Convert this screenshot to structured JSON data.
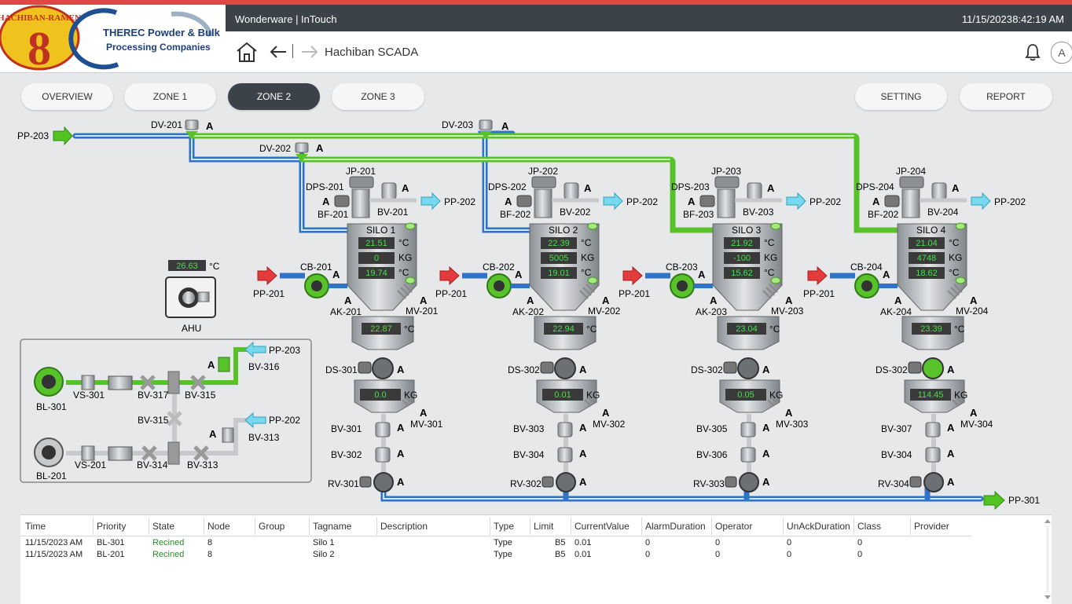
{
  "logos": {
    "ramen_brand": "HACHIBAN-RAMEN",
    "ramen_mark": "8",
    "therec_line1": "THEREC Powder & Bulk",
    "therec_line2": "Processing Companies"
  },
  "titlebar": {
    "app": "Wonderware | InTouch",
    "date": "11/15/2023",
    "time": "8:42:19 AM"
  },
  "nav": {
    "breadcrumb": "Hachiban SCADA",
    "user_initial": "A"
  },
  "tabs": [
    {
      "label": "OVERVIEW",
      "active": false
    },
    {
      "label": "ZONE 1",
      "active": false
    },
    {
      "label": "ZONE 2",
      "active": true
    },
    {
      "label": "ZONE 3",
      "active": false
    }
  ],
  "right_tabs": [
    {
      "label": "SETTING"
    },
    {
      "label": "REPORT"
    }
  ],
  "colors": {
    "pipe_green": "#58c22a",
    "pipe_blue": "#2f73c8",
    "arrow_red": "#e33b3b",
    "arrow_cyan": "#78d8ee",
    "arrow_green": "#53c322",
    "display_bg": "#3a3a3a",
    "display_fg": "#47e04a"
  },
  "header_pipes": {
    "pp203": "PP-203",
    "dv201": "DV-201",
    "dv202": "DV-202",
    "dv203": "DV-203",
    "auto": "A"
  },
  "ahu": {
    "label": "AHU",
    "temp": "26.63",
    "unit": "°C"
  },
  "blower_panel": {
    "bl301": "BL-301",
    "vs301": "VS-301",
    "bv317": "BV-317",
    "bv315a": "BV-315",
    "bv316": "BV-316",
    "pp203": "PP-203",
    "bv315b": "BV-315",
    "bv313a": "BV-313",
    "pp202": "PP-202",
    "bl201": "BL-201",
    "vs201": "VS-201",
    "bv314": "BV-314",
    "bv313b": "BV-313",
    "auto": "A"
  },
  "silos": [
    {
      "name": "SILO 1",
      "jp": "JP-201",
      "dps": "DPS-201",
      "bf": "BF-201",
      "bv": "BV-201",
      "out": "PP-202",
      "cb": "CB-201",
      "in": "PP-201",
      "ak": "AK-201",
      "mv": "MV-201",
      "temp1": "21.51",
      "weight": "0",
      "temp2": "19.74",
      "temp3": "22.87",
      "ds": "DS-301",
      "weight2": "0.0",
      "mv2": "MV-301",
      "bva": "BV-301",
      "bvb": "BV-302",
      "rv": "RV-301"
    },
    {
      "name": "SILO 2",
      "jp": "JP-202",
      "dps": "DPS-202",
      "bf": "BF-202",
      "bv": "BV-202",
      "out": "PP-202",
      "cb": "CB-202",
      "in": "PP-201",
      "ak": "AK-202",
      "mv": "MV-202",
      "temp1": "22.39",
      "weight": "5005",
      "temp2": "19.01",
      "temp3": "22.94",
      "ds": "DS-302",
      "weight2": "0.01",
      "mv2": "MV-302",
      "bva": "BV-303",
      "bvb": "BV-304",
      "rv": "RV-302"
    },
    {
      "name": "SILO 3",
      "jp": "JP-203",
      "dps": "DPS-203",
      "bf": "BF-203",
      "bv": "BV-203",
      "out": "PP-202",
      "cb": "CB-203",
      "in": "PP-201",
      "ak": "AK-203",
      "mv": "MV-203",
      "temp1": "21.92",
      "weight": "-100",
      "temp2": "15.62",
      "temp3": "23.04",
      "ds": "DS-302",
      "weight2": "0.05",
      "mv2": "MV-303",
      "bva": "BV-305",
      "bvb": "BV-306",
      "rv": "RV-303"
    },
    {
      "name": "SILO 4",
      "jp": "JP-204",
      "dps": "DPS-204",
      "bf": "BF-202",
      "bv": "BV-204",
      "out": "PP-202",
      "cb": "CB-204",
      "in": "PP-201",
      "ak": "AK-204",
      "mv": "MV-204",
      "temp1": "21.04",
      "weight": "4748",
      "temp2": "18.62",
      "temp3": "23.39",
      "ds": "DS-302",
      "weight2": "114.45",
      "mv2": "MV-304",
      "bva": "BV-307",
      "bvb": "BV-304",
      "rv": "RV-304"
    }
  ],
  "units": {
    "c": "°C",
    "kg": "KG"
  },
  "discharge": {
    "label": "PP-301"
  },
  "alarm_table": {
    "columns": [
      "Time",
      "Priority",
      "State",
      "Node",
      "Group",
      "Tagname",
      "Description",
      "Type",
      "Limit",
      "CurrentValue",
      "AlarmDuration",
      "Operator",
      "UnAckDuration",
      "Class",
      "Provider"
    ],
    "rows": [
      [
        "11/15/2023 AM",
        "BL-301",
        "Recined",
        "8",
        "",
        "Silo 1",
        "",
        "Type",
        "B5",
        "0.01",
        "0",
        "0",
        "0",
        "0",
        ""
      ],
      [
        "11/15/2023 AM",
        "BL-201",
        "Recined",
        "8",
        "",
        "Silo 2",
        "",
        "Type",
        "B5",
        "0.01",
        "0",
        "0",
        "0",
        "0",
        ""
      ]
    ]
  }
}
